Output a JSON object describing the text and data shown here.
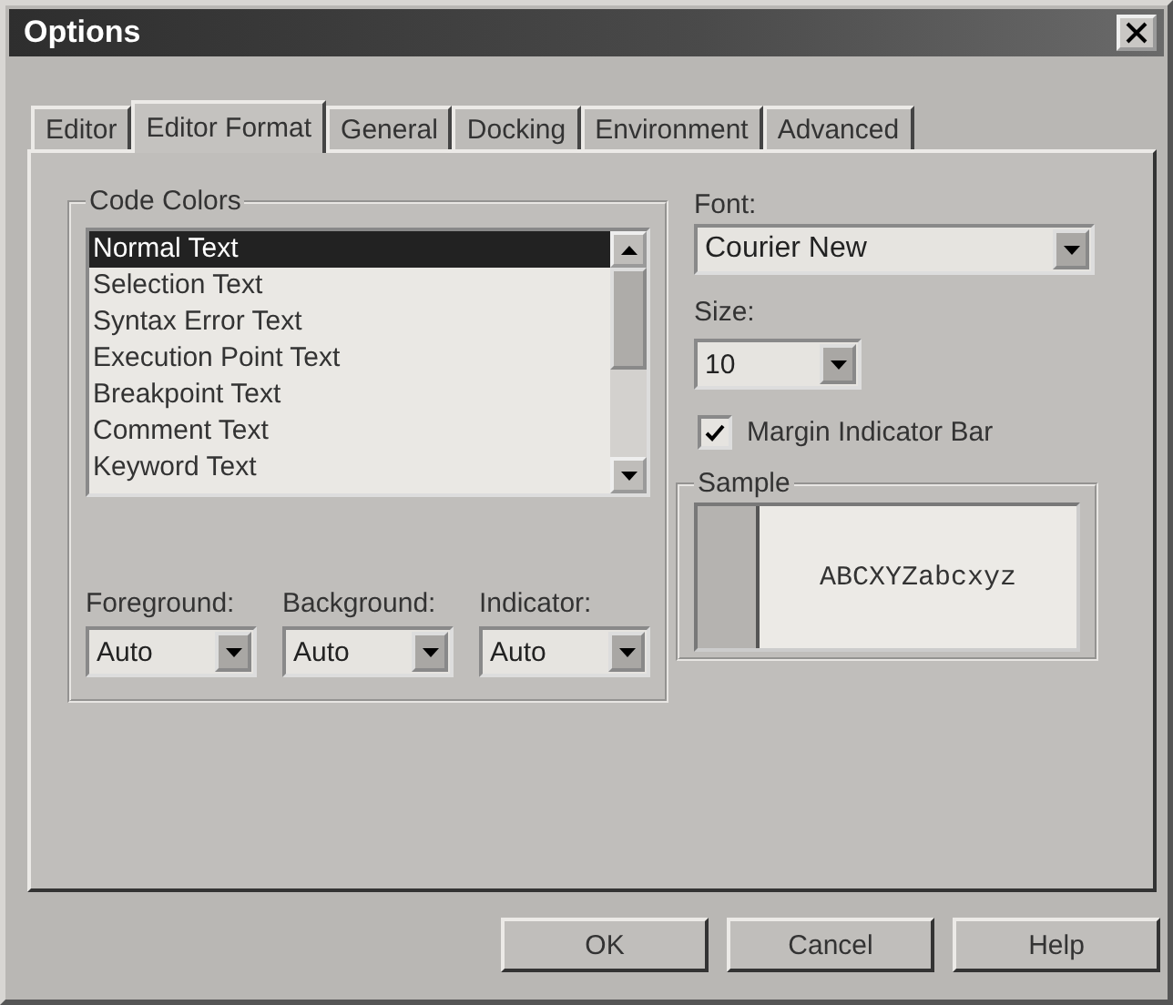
{
  "window": {
    "title": "Options"
  },
  "tabs": [
    {
      "label": "Editor",
      "selected": false
    },
    {
      "label": "Editor Format",
      "selected": true
    },
    {
      "label": "General",
      "selected": false
    },
    {
      "label": "Docking",
      "selected": false
    },
    {
      "label": "Environment",
      "selected": false
    },
    {
      "label": "Advanced",
      "selected": false
    }
  ],
  "code_colors": {
    "label": "Code Colors",
    "items": [
      {
        "label": "Normal Text",
        "selected": true
      },
      {
        "label": "Selection Text",
        "selected": false
      },
      {
        "label": "Syntax Error Text",
        "selected": false
      },
      {
        "label": "Execution Point Text",
        "selected": false
      },
      {
        "label": "Breakpoint Text",
        "selected": false
      },
      {
        "label": "Comment Text",
        "selected": false
      },
      {
        "label": "Keyword Text",
        "selected": false
      }
    ],
    "dropdowns": [
      {
        "label": "Foreground:",
        "value": "Auto"
      },
      {
        "label": "Background:",
        "value": "Auto"
      },
      {
        "label": "Indicator:",
        "value": "Auto"
      }
    ]
  },
  "font": {
    "label": "Font:",
    "value": "Courier New"
  },
  "size": {
    "label": "Size:",
    "value": "10"
  },
  "margin_indicator_bar": {
    "label": "Margin Indicator Bar",
    "checked": true
  },
  "sample": {
    "label": "Sample",
    "text": "ABCXYZabcxyz"
  },
  "buttons": [
    {
      "label": "OK"
    },
    {
      "label": "Cancel"
    },
    {
      "label": "Help"
    }
  ]
}
